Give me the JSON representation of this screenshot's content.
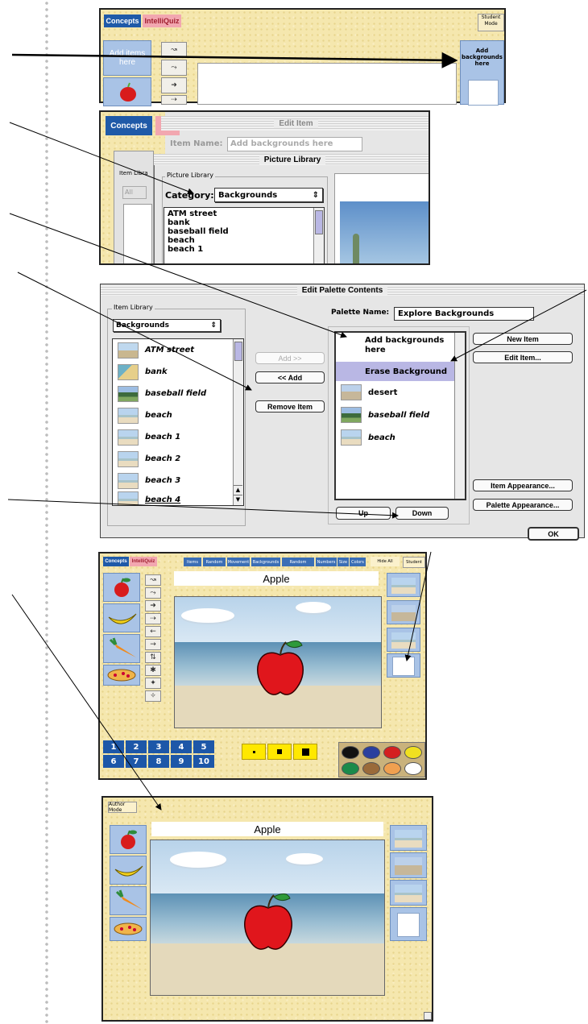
{
  "panel1": {
    "tab_concepts": "Concepts",
    "tab_intelliquiz": "IntelliQuiz",
    "student_mode": "Student\nMode",
    "add_items": "Add items\nhere",
    "add_backgrounds": "Add\nbackgrounds\nhere"
  },
  "panel2": {
    "tab_concepts": "Concepts",
    "edit_item_title": "Edit Item",
    "item_name_label": "Item Name:",
    "item_name_value": "Add backgrounds here",
    "picture_library_title": "Picture Library",
    "item_library_label": "Item Libra",
    "all_select": "All",
    "picture_library_group": "Picture Library",
    "category_label": "Category:",
    "category_value": "Backgrounds",
    "list": [
      "ATM street",
      "bank",
      "baseball field",
      "beach",
      "beach 1"
    ]
  },
  "palette": {
    "title": "Edit Palette Contents",
    "item_library_label": "Item Library",
    "library_select": "Backgrounds",
    "library_items": [
      "ATM street",
      "bank",
      "baseball field",
      "beach",
      "beach 1",
      "beach 2",
      "beach 3",
      "beach 4"
    ],
    "add_button": "Add >>",
    "remove_add_button": "<< Add",
    "remove_item_button": "Remove Item",
    "palette_name_label": "Palette Name:",
    "palette_name_value": "Explore Backgrounds",
    "palette_items": [
      "Add backgrounds here",
      "Erase Background",
      "desert",
      "baseball field",
      "beach"
    ],
    "new_item": "New Item",
    "edit_item": "Edit Item...",
    "item_appearance": "Item Appearance...",
    "palette_appearance": "Palette Appearance...",
    "up": "Up",
    "down": "Down",
    "ok": "OK"
  },
  "author": {
    "tab_concepts": "Concepts",
    "tab_intelliquiz": "IntelliQuiz",
    "menu_tabs": [
      "Items",
      "Random",
      "Movement",
      "Backgrounds",
      "Random",
      "Numbers",
      "Size",
      "Colors"
    ],
    "hide_all": "Hide All",
    "student": "Student",
    "label": "Apple",
    "numbers_row1": [
      "1",
      "2",
      "3",
      "4",
      "5"
    ],
    "numbers_row2": [
      "6",
      "7",
      "8",
      "9",
      "10"
    ],
    "colors": [
      "#111111",
      "#2a3f9e",
      "#d42020",
      "#f0e020",
      "#1a8a4a",
      "#9a6a3a",
      "#f0a050",
      "#ffffff"
    ]
  },
  "student": {
    "author_mode": "Author Mode",
    "label": "Apple"
  }
}
